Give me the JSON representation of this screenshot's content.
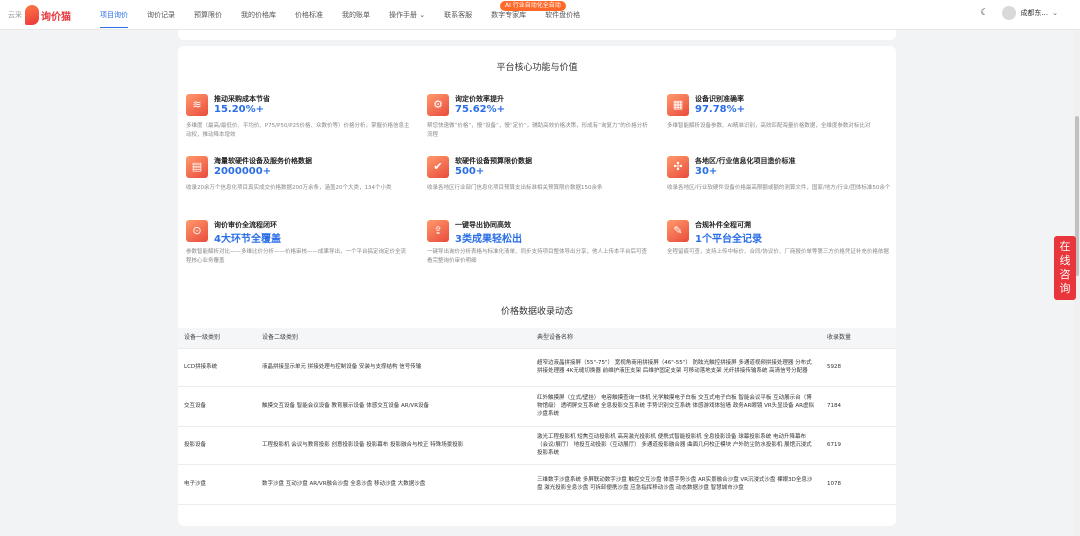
{
  "header": {
    "logo_small": "云采",
    "logo_text": "询价猫",
    "ai_badge": "AI 行业自动化全自动",
    "nav": [
      "项目询价",
      "询价记录",
      "预算限价",
      "我的价格库",
      "价格标准",
      "我的账单",
      "操作手册 ⌄",
      "联系客服",
      "数字专家库",
      "软件盘价格"
    ],
    "user": "成都东...",
    "moon_icon": "☾",
    "chevron": "⌄"
  },
  "section1": {
    "title": "平台核心功能与价值",
    "features": [
      {
        "icon": "≋",
        "name": "推动采购成本节省",
        "value": "15.20%+",
        "desc": "多维度（最高/最低价、平均价、P75/P50/P25价格、众数价等）价格分析，掌握价格信息主动权，推动降本增效"
      },
      {
        "icon": "⚙",
        "name": "询定价效率提升",
        "value": "75.62%+",
        "desc": "帮您快速做“价格”，慢“设备”，慢“定价”，辅助高效价格决策，形成有“询复力”的价格分析流程"
      },
      {
        "icon": "▦",
        "name": "设备识别准确率",
        "value": "97.78%+",
        "desc": "多维智能解析设备参数、AI精准识别，高效匹配海量价格数据，全维度参数对标比对"
      },
      {
        "icon": "▤",
        "name": "海量软硬件设备及服务价格数据",
        "value": "2000000+",
        "desc": "收录20余万个信息化项目真实成交价格数据200万余条，涵盖20个大类，134个小类"
      },
      {
        "icon": "✔",
        "name": "软硬件设备预算限价数据",
        "value": "500+",
        "desc": "收录各地区行业部门信息化项目预算支出标准相关预算限价数据150余条"
      },
      {
        "icon": "✣",
        "name": "各地区/行业信息化项目造价标准",
        "value": "30+",
        "desc": "收录各地区/行业软硬件设备价格最高限额或额的测算文件，国家/地方/行业/团体标准50余个"
      },
      {
        "icon": "⊙",
        "name": "询价审价全流程闭环",
        "value": "4大环节全覆盖",
        "desc": "参数智能解析对比——多维比价分析——价格审核——成果导出，一个平台搞定询定价全流程核心业务覆盖"
      },
      {
        "icon": "⇪",
        "name": "一键导出协同高效",
        "value": "3类成果轻松出",
        "desc": "一键导出询价分析表格与标准化清单、同步支持项目整体导出分享，他人上传本平台后可查看完整询价审价明细"
      },
      {
        "icon": "✎",
        "name": "合规补件全程可溯",
        "value": "1个平台全记录",
        "desc": "全程留痕可查，支持上传中标价、合同/协议价、厂商报价单等第三方价格凭证补充价格依据"
      }
    ]
  },
  "section2": {
    "title": "价格数据收录动态",
    "columns": [
      "设备一级类别",
      "设备二级类别",
      "典型设备名称",
      "收录数量"
    ],
    "rows": [
      {
        "c1": "LCD拼接系统",
        "c2": "液晶拼接显示单元 拼接处理与控制设备 安装与支撑结构 信号传输",
        "c3": "超窄边液晶拼接屏（55\"-75\"） 宽视角商用拼接屏（46\"-55\"） 防眩光触控拼接屏 多通道视频拼接处理器 分布式拼接处理器 4K无缝切换器 前维护液压支架 后维护固定支架 可移动落地支架 光纤拼接传输系统 高清信号分配器",
        "c4": "5928"
      },
      {
        "c1": "交互设备",
        "c2": "触摸交互设备 智能会议设备 教育展示设备 体感交互设备 AR/VR设备",
        "c3": "红外触摸屏（立式/壁挂） 电容触摸查询一体机 光学触摸电子白板 交互式电子白板 智能会议平板 互动展示台（博物馆级） 透明屏交互系统 全息投影交互系统 手势识别交互系统 体感游戏体验墙 政务AR眼镜 VR头显设备 AR虚拟沙盘系统",
        "c4": "7184"
      },
      {
        "c1": "投影设备",
        "c2": "工程投影机 会议与教育投影 创意投影设备 投影幕布 投影融合与校正 特殊场景投影",
        "c3": "激光工程投影机 短焦互动投影机 高亮激光投影机 便携式智能投影机 全息投影设备 球幕投影系统 电动升降幕布（会议/展厅） 地投互动投影（互动展厅） 多通道投影融合器 曲面几何校正模块 户外防尘防水投影机 展馆沉浸式投影系统",
        "c4": "6719"
      },
      {
        "c1": "电子沙盘",
        "c2": "数字沙盘 互动沙盘 AR/VR融合沙盘 全息沙盘 移动沙盘 大数据沙盘",
        "c3": "三维数字沙盘系统 多屏联动数字沙盘 触控交互沙盘 体感手势沙盘 AR实景融合沙盘 VR沉浸式沙盘 裸眼3D全息沙盘 激光投影全息沙盘 可拆卸便携沙盘 应急指挥移动沙盘 动态数据沙盘 智慧城市沙盘",
        "c4": "1078"
      }
    ]
  },
  "float_button": [
    "在",
    "线",
    "咨",
    "询"
  ]
}
